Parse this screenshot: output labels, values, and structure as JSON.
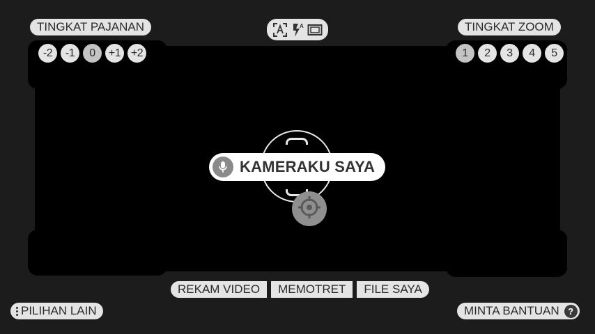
{
  "exposure": {
    "title": "TINGKAT PAJANAN",
    "levels": [
      "-2",
      "-1",
      "0",
      "+1",
      "+2"
    ],
    "selected": "0"
  },
  "zoom": {
    "title": "TINGKAT ZOOM",
    "levels": [
      "1",
      "2",
      "3",
      "4",
      "5"
    ],
    "selected": "1"
  },
  "top_modes": {
    "icons": [
      "auto-focus-icon",
      "flash-auto-icon",
      "aspect-ratio-icon"
    ]
  },
  "voice": {
    "label": "KAMERAKU SAYA",
    "icon": "microphone-icon"
  },
  "shutter": {
    "icon": "target-icon"
  },
  "bottom_tabs": [
    {
      "label": "REKAM VIDEO"
    },
    {
      "label": "MEMOTRET"
    },
    {
      "label": "FILE SAYA"
    }
  ],
  "more_options": {
    "label": "PILIHAN LAIN",
    "icon": "more-vertical-icon"
  },
  "help": {
    "label": "MINTA BANTUAN",
    "icon_text": "?"
  },
  "colors": {
    "background": "#1c1c1c",
    "viewfinder": "#000000",
    "pill": "#e4e4e4"
  }
}
